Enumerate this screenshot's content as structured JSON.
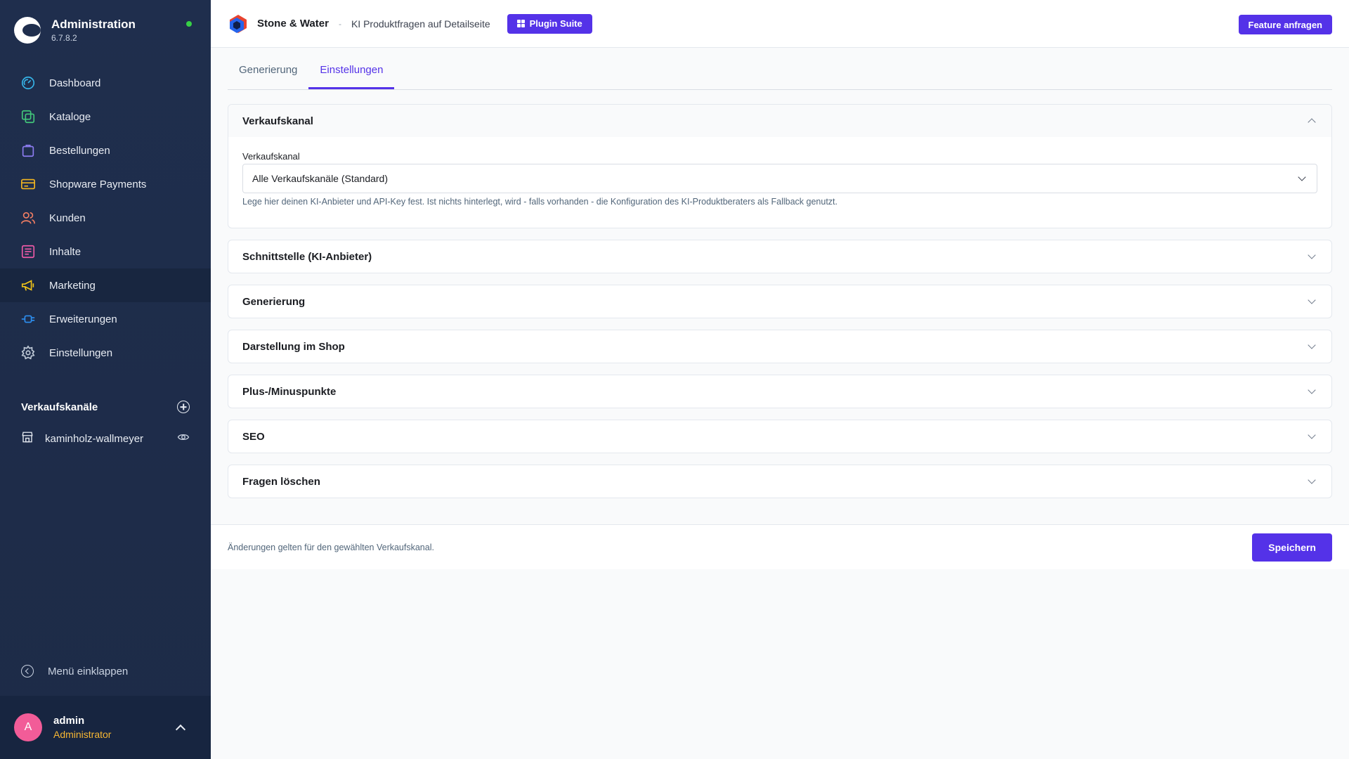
{
  "app": {
    "title": "Administration",
    "version": "6.7.8.2"
  },
  "nav": {
    "items": [
      {
        "label": "Dashboard",
        "icon": "dashboard-icon",
        "color": "#36b5e8"
      },
      {
        "label": "Kataloge",
        "icon": "catalog-icon",
        "color": "#42c77a"
      },
      {
        "label": "Bestellungen",
        "icon": "shopping-bag-icon",
        "color": "#8c7cf0"
      },
      {
        "label": "Shopware Payments",
        "icon": "credit-card-icon",
        "color": "#f2b520"
      },
      {
        "label": "Kunden",
        "icon": "customers-icon",
        "color": "#f27e63"
      },
      {
        "label": "Inhalte",
        "icon": "content-icon",
        "color": "#ee5aa7"
      },
      {
        "label": "Marketing",
        "icon": "megaphone-icon",
        "color": "#f2c518"
      },
      {
        "label": "Erweiterungen",
        "icon": "plug-icon",
        "color": "#2d8ff0"
      },
      {
        "label": "Einstellungen",
        "icon": "gear-icon",
        "color": "#c2ccd9"
      }
    ],
    "active_index": 6
  },
  "sales_channels": {
    "title": "Verkaufskanäle",
    "item": "kaminholz-wallmeyer"
  },
  "collapse_label": "Menü einklappen",
  "user": {
    "initial": "A",
    "name": "admin",
    "role": "Administrator"
  },
  "topbar": {
    "company": "Stone & Water",
    "separator": "-",
    "plugin_name": "KI Produktfragen auf Detailseite",
    "suite_button": "Plugin Suite",
    "feature_button": "Feature anfragen"
  },
  "tabs": [
    "Generierung",
    "Einstellungen"
  ],
  "active_tab": 1,
  "sales_channel_card": {
    "title": "Verkaufskanal",
    "field_label": "Verkaufskanal",
    "selected_value": "Alle Verkaufskanäle (Standard)",
    "hint": "Lege hier deinen KI-Anbieter und API-Key fest. Ist nichts hinterlegt, wird - falls vorhanden - die Konfiguration des KI-Produktberaters als Fallback genutzt."
  },
  "sections": [
    "Schnittstelle (KI-Anbieter)",
    "Generierung",
    "Darstellung im Shop",
    "Plus-/Minuspunkte",
    "SEO",
    "Fragen löschen"
  ],
  "footer": {
    "note": "Änderungen gelten für den gewählten Verkaufskanal.",
    "save_label": "Speichern"
  }
}
